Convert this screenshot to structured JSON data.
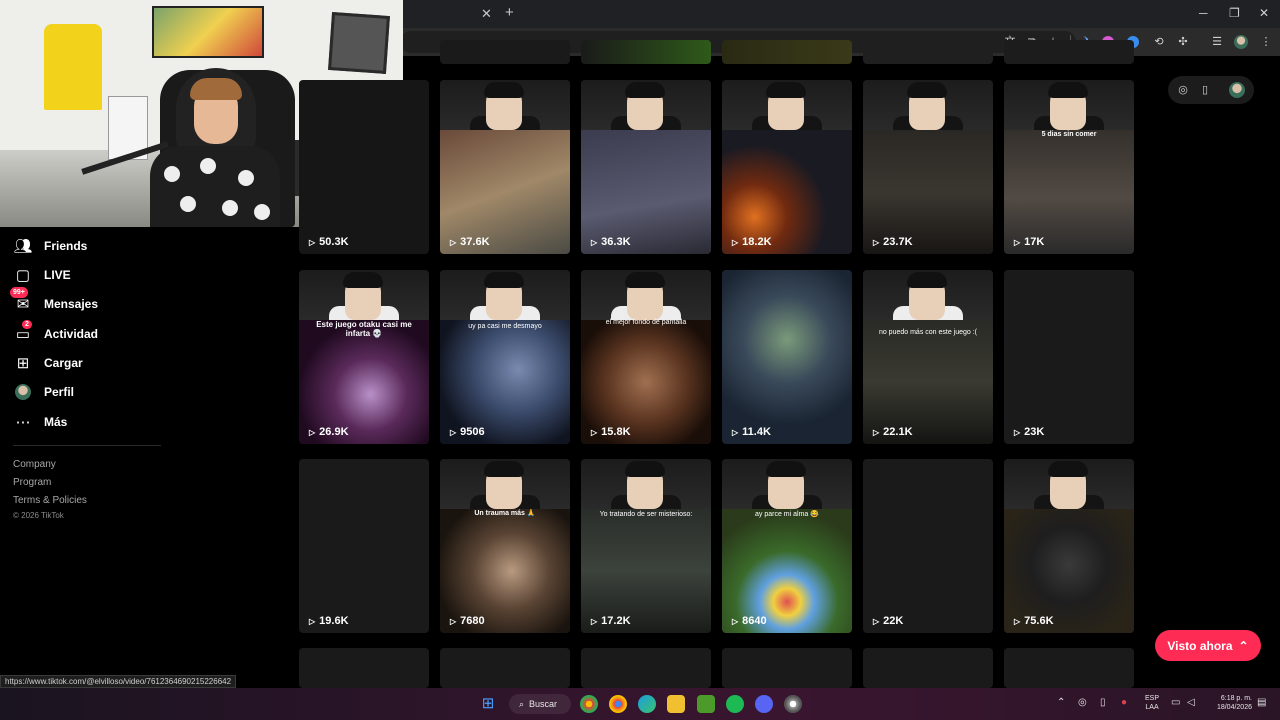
{
  "window_controls": {
    "minimize": "─",
    "restore": "❐",
    "close": "✕"
  },
  "tab": {
    "close_glyph": "✕",
    "new_tab_glyph": "+"
  },
  "sidebar": {
    "items": [
      {
        "label": "Friends",
        "icon": "friends-icon"
      },
      {
        "label": "LIVE",
        "icon": "live-icon"
      },
      {
        "label": "Mensajes",
        "icon": "messages-icon",
        "badge": "99+"
      },
      {
        "label": "Actividad",
        "icon": "activity-icon",
        "badge": "2"
      },
      {
        "label": "Cargar",
        "icon": "upload-icon"
      },
      {
        "label": "Perfil",
        "icon": "profile-avatar"
      },
      {
        "label": "Más",
        "icon": "more-icon"
      }
    ],
    "footer": [
      "Company",
      "Program",
      "Terms & Policies"
    ],
    "copyright": "© 2026 TikTok"
  },
  "videos": [
    {
      "views": "50.3K",
      "caption": ""
    },
    {
      "views": "37.6K",
      "caption": ""
    },
    {
      "views": "36.3K",
      "caption": ""
    },
    {
      "views": "18.2K",
      "caption": ""
    },
    {
      "views": "23.7K",
      "caption": ""
    },
    {
      "views": "17K",
      "caption": "5 dias sin comer"
    },
    {
      "views": "26.9K",
      "caption": "Este juego otaku casi me infarta 💀"
    },
    {
      "views": "9506",
      "caption": "uy pa casi me desmayo"
    },
    {
      "views": "15.8K",
      "caption": "el mejor fondo de pantalla"
    },
    {
      "views": "11.4K",
      "caption": ""
    },
    {
      "views": "22.1K",
      "caption": "no puedo más con este juego :("
    },
    {
      "views": "23K",
      "caption": ""
    },
    {
      "views": "19.6K",
      "caption": ""
    },
    {
      "views": "7680",
      "caption": "Un trauma más 🙏"
    },
    {
      "views": "17.2K",
      "caption": "Yo tratando de ser misterioso:"
    },
    {
      "views": "8640",
      "caption": "ay parce mi alma 😂"
    },
    {
      "views": "22K",
      "caption": ""
    },
    {
      "views": "75.6K",
      "caption": ""
    }
  ],
  "visto_ahora": {
    "label": "Visto ahora",
    "icon": "chevron-up-double-icon"
  },
  "status_url": "https://www.tiktok.com/@elvilloso/video/7612364690215226642",
  "taskbar": {
    "search_label": "Buscar",
    "lang_top": "ESP",
    "lang_bottom": "LAA",
    "time": "6:18 p. m.",
    "date": "18/04/2026"
  },
  "colors": {
    "accent": "#fe2c55",
    "background": "#000000",
    "card": "#161616"
  }
}
